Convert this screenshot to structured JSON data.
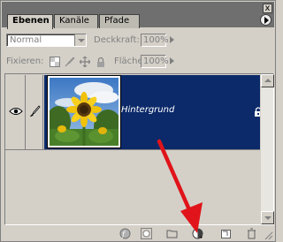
{
  "tabs": [
    {
      "label": "Ebenen",
      "active": true
    },
    {
      "label": "Kanäle",
      "active": false
    },
    {
      "label": "Pfade",
      "active": false
    }
  ],
  "close_label": "x",
  "options": {
    "blend_mode": "Normal",
    "opacity_label": "Deckkraft:",
    "opacity_value": "100%",
    "lock_label": "Fixieren:",
    "fill_label": "Fläche",
    "fill_value": "100%"
  },
  "layers": [
    {
      "name": "Hintergrund",
      "visible": true,
      "selected": true,
      "locked": true
    }
  ],
  "colors": {
    "panel_bg": "#d4d0c8",
    "selection": "#0c2a6a",
    "tab_strip": "#6f6f6f",
    "annotation_arrow": "#e0141a"
  },
  "bottom_icons": [
    "layer-style-icon",
    "add-mask-icon",
    "new-group-icon",
    "new-adjustment-layer-icon",
    "new-layer-icon",
    "trash-icon"
  ]
}
